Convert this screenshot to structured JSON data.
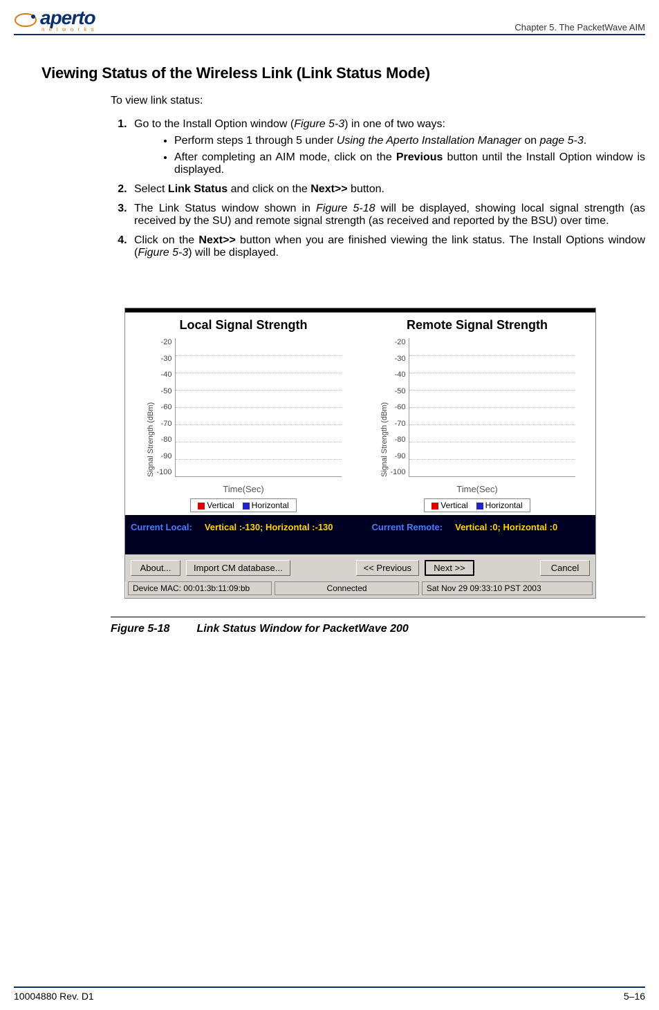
{
  "header": {
    "logo_main": "aperto",
    "logo_sub": "n e t w o r k s",
    "chapter": "Chapter 5.  The PacketWave AIM"
  },
  "section_title": "Viewing Status of the Wireless Link (Link Status Mode)",
  "intro": "To view link status:",
  "steps": {
    "s1_a": "Go to the Install Option window (",
    "s1_fig": "Figure 5-3",
    "s1_b": ") in one of two ways:",
    "s1_sub1_a": "Perform steps 1 through 5 under ",
    "s1_sub1_em": "Using the Aperto Installation Manager",
    "s1_sub1_b": " on ",
    "s1_sub1_em2": "page 5-3",
    "s1_sub1_c": ".",
    "s1_sub2_a": "After completing an AIM mode, click on the ",
    "s1_sub2_bold": "Previous",
    "s1_sub2_b": " button until the Install Option window is displayed.",
    "s2_a": "Select ",
    "s2_bold1": "Link Status",
    "s2_b": " and click on the ",
    "s2_bold2": "Next>>",
    "s2_c": " button.",
    "s3_a": "The Link Status window shown in ",
    "s3_fig": "Figure 5-18",
    "s3_b": " will be displayed, showing local signal strength (as received by the SU) and remote signal strength (as received and reported by the BSU) over time.",
    "s4_a": "Click on the ",
    "s4_bold": "Next>>",
    "s4_b": " button when you are finished viewing the link status. The Install Options window (",
    "s4_fig": "Figure 5-3",
    "s4_c": ") will be displayed."
  },
  "window": {
    "local_title": "Local Signal Strength",
    "remote_title": "Remote Signal Strength",
    "ylabel": "Signal Strength (dBm)",
    "xlabel": "Time(Sec)",
    "legend_v": "Vertical",
    "legend_h": "Horizontal",
    "current_local_lbl": "Current Local:",
    "current_local_val": "Vertical :-130; Horizontal :-130",
    "current_remote_lbl": "Current Remote:",
    "current_remote_val": "Vertical :0; Horizontal :0",
    "btn_about": "About...",
    "btn_import": "Import CM database...",
    "btn_prev": "<< Previous",
    "btn_next": "Next >>",
    "btn_cancel": "Cancel",
    "status_mac": "Device MAC: 00:01:3b:11:09:bb",
    "status_conn": "Connected",
    "status_time": "Sat Nov 29 09:33:10 PST 2003"
  },
  "chart_data": [
    {
      "type": "line",
      "title": "Local Signal Strength",
      "xlabel": "Time(Sec)",
      "ylabel": "Signal Strength (dBm)",
      "ylim": [
        -100,
        -20
      ],
      "yticks": [
        -20,
        -30,
        -40,
        -50,
        -60,
        -70,
        -80,
        -90,
        -100
      ],
      "series": [
        {
          "name": "Vertical",
          "color": "#d00",
          "values": []
        },
        {
          "name": "Horizontal",
          "color": "#22c",
          "values": []
        }
      ]
    },
    {
      "type": "line",
      "title": "Remote Signal Strength",
      "xlabel": "Time(Sec)",
      "ylabel": "Signal Strength (dBm)",
      "ylim": [
        -100,
        -20
      ],
      "yticks": [
        -20,
        -30,
        -40,
        -50,
        -60,
        -70,
        -80,
        -90,
        -100
      ],
      "series": [
        {
          "name": "Vertical",
          "color": "#d00",
          "values": []
        },
        {
          "name": "Horizontal",
          "color": "#22c",
          "values": []
        }
      ]
    }
  ],
  "yticks": {
    "t0": "-20",
    "t1": "-30",
    "t2": "-40",
    "t3": "-50",
    "t4": "-60",
    "t5": "-70",
    "t6": "-80",
    "t7": "-90",
    "t8": "-100"
  },
  "caption": {
    "num": "Figure 5-18",
    "text": "Link Status Window for PacketWave 200"
  },
  "footer": {
    "left": "10004880 Rev. D1",
    "right": "5–16"
  }
}
